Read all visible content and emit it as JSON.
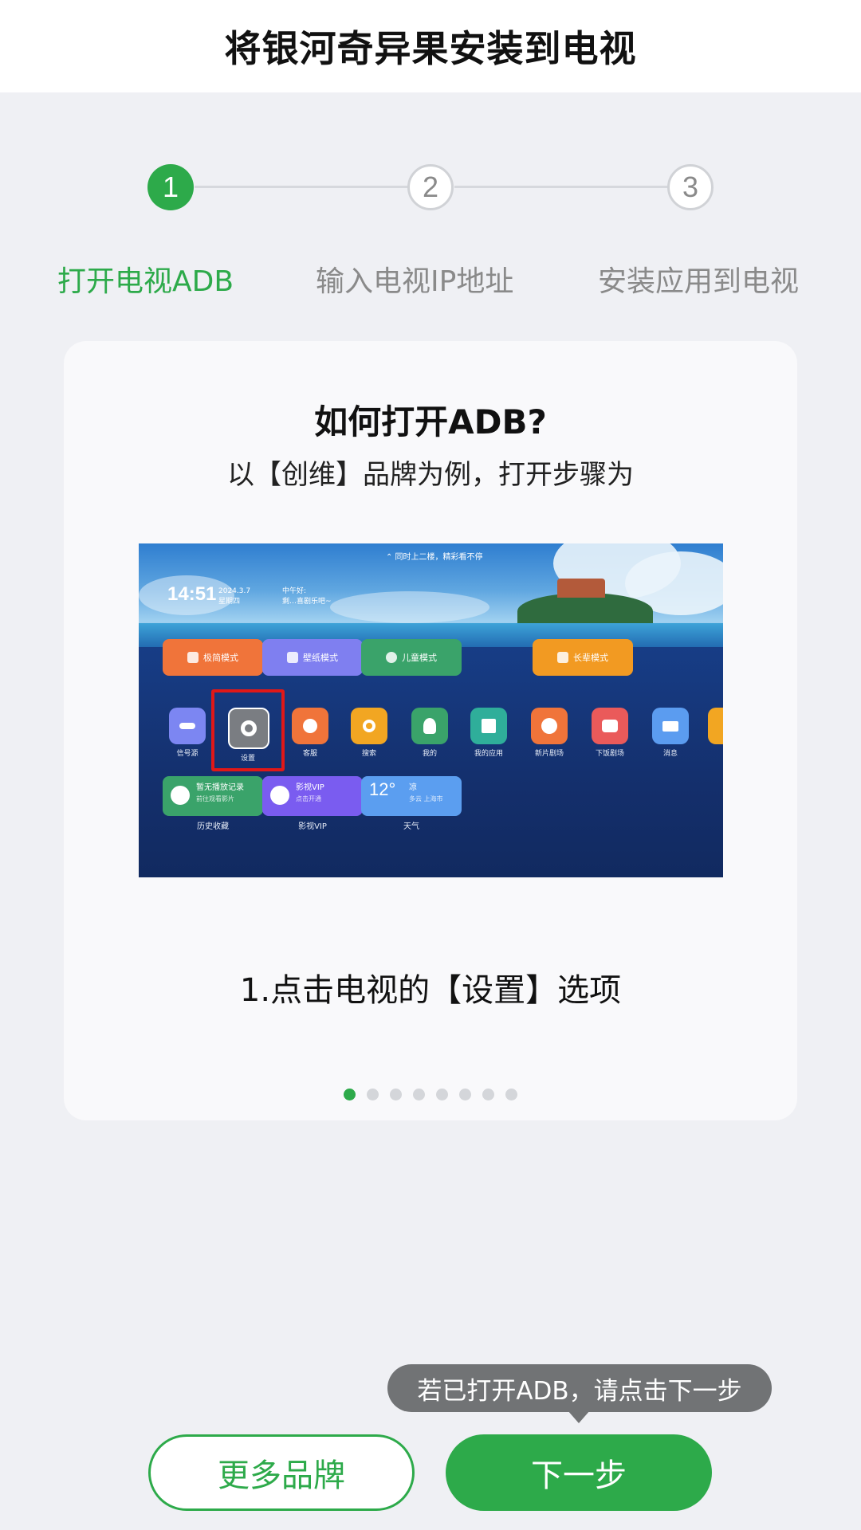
{
  "header": {
    "title": "将银河奇异果安装到电视"
  },
  "stepper": {
    "steps": [
      {
        "number": "1",
        "label": "打开电视ADB",
        "state": "active"
      },
      {
        "number": "2",
        "label": "输入电视IP地址",
        "state": "inactive"
      },
      {
        "number": "3",
        "label": "安装应用到电视",
        "state": "inactive"
      }
    ]
  },
  "card": {
    "title": "如何打开ADB?",
    "subtitle": "以【创维】品牌为例，打开步骤为",
    "caption": "1.点击电视的【设置】选项",
    "pagination": {
      "total": 8,
      "current": 1
    },
    "screenshot": {
      "notice": "⌃ 同时上二楼，精彩看不停",
      "time": "14:51",
      "date": "2024.3.7",
      "weekday": "星期四",
      "greeting": "中午好:",
      "greeting_sub": "剩…喜剧乐吧~",
      "modes": [
        {
          "label": "极简模式",
          "color": "#f0743a"
        },
        {
          "label": "壁纸模式",
          "color": "#7f7ff0"
        },
        {
          "label": "儿童模式",
          "color": "#3aa36a"
        },
        {
          "label": "长辈模式",
          "color": "#f29a22"
        }
      ],
      "apps": [
        {
          "label": "信号源",
          "color": "#7c86f2"
        },
        {
          "label": "设置",
          "color": "#7a7d82"
        },
        {
          "label": "客服",
          "color": "#f0743a"
        },
        {
          "label": "搜索",
          "color": "#f2a622"
        },
        {
          "label": "我的",
          "color": "#3aa36a"
        },
        {
          "label": "我的应用",
          "color": "#2fae9a"
        },
        {
          "label": "新片剧场",
          "color": "#f0743a"
        },
        {
          "label": "下饭剧场",
          "color": "#ea5a5a"
        },
        {
          "label": "消息",
          "color": "#5b9cf0"
        }
      ],
      "tiles": [
        {
          "title": "暂无播放记录",
          "sub": "前往观看影片",
          "label": "历史收藏",
          "color": "#3aa36a"
        },
        {
          "title": "影视VIP",
          "sub": "点击开通",
          "label": "影视VIP",
          "color": "#7a5cf0"
        },
        {
          "title": "凉",
          "sub": "多云 上海市",
          "temp": "12°",
          "label": "天气",
          "color": "#5b9ef0"
        }
      ]
    }
  },
  "tooltip": {
    "text": "若已打开ADB，请点击下一步"
  },
  "buttons": {
    "more_brands": "更多品牌",
    "next": "下一步"
  },
  "colors": {
    "accent": "#2daa4a",
    "background": "#eff0f4"
  }
}
